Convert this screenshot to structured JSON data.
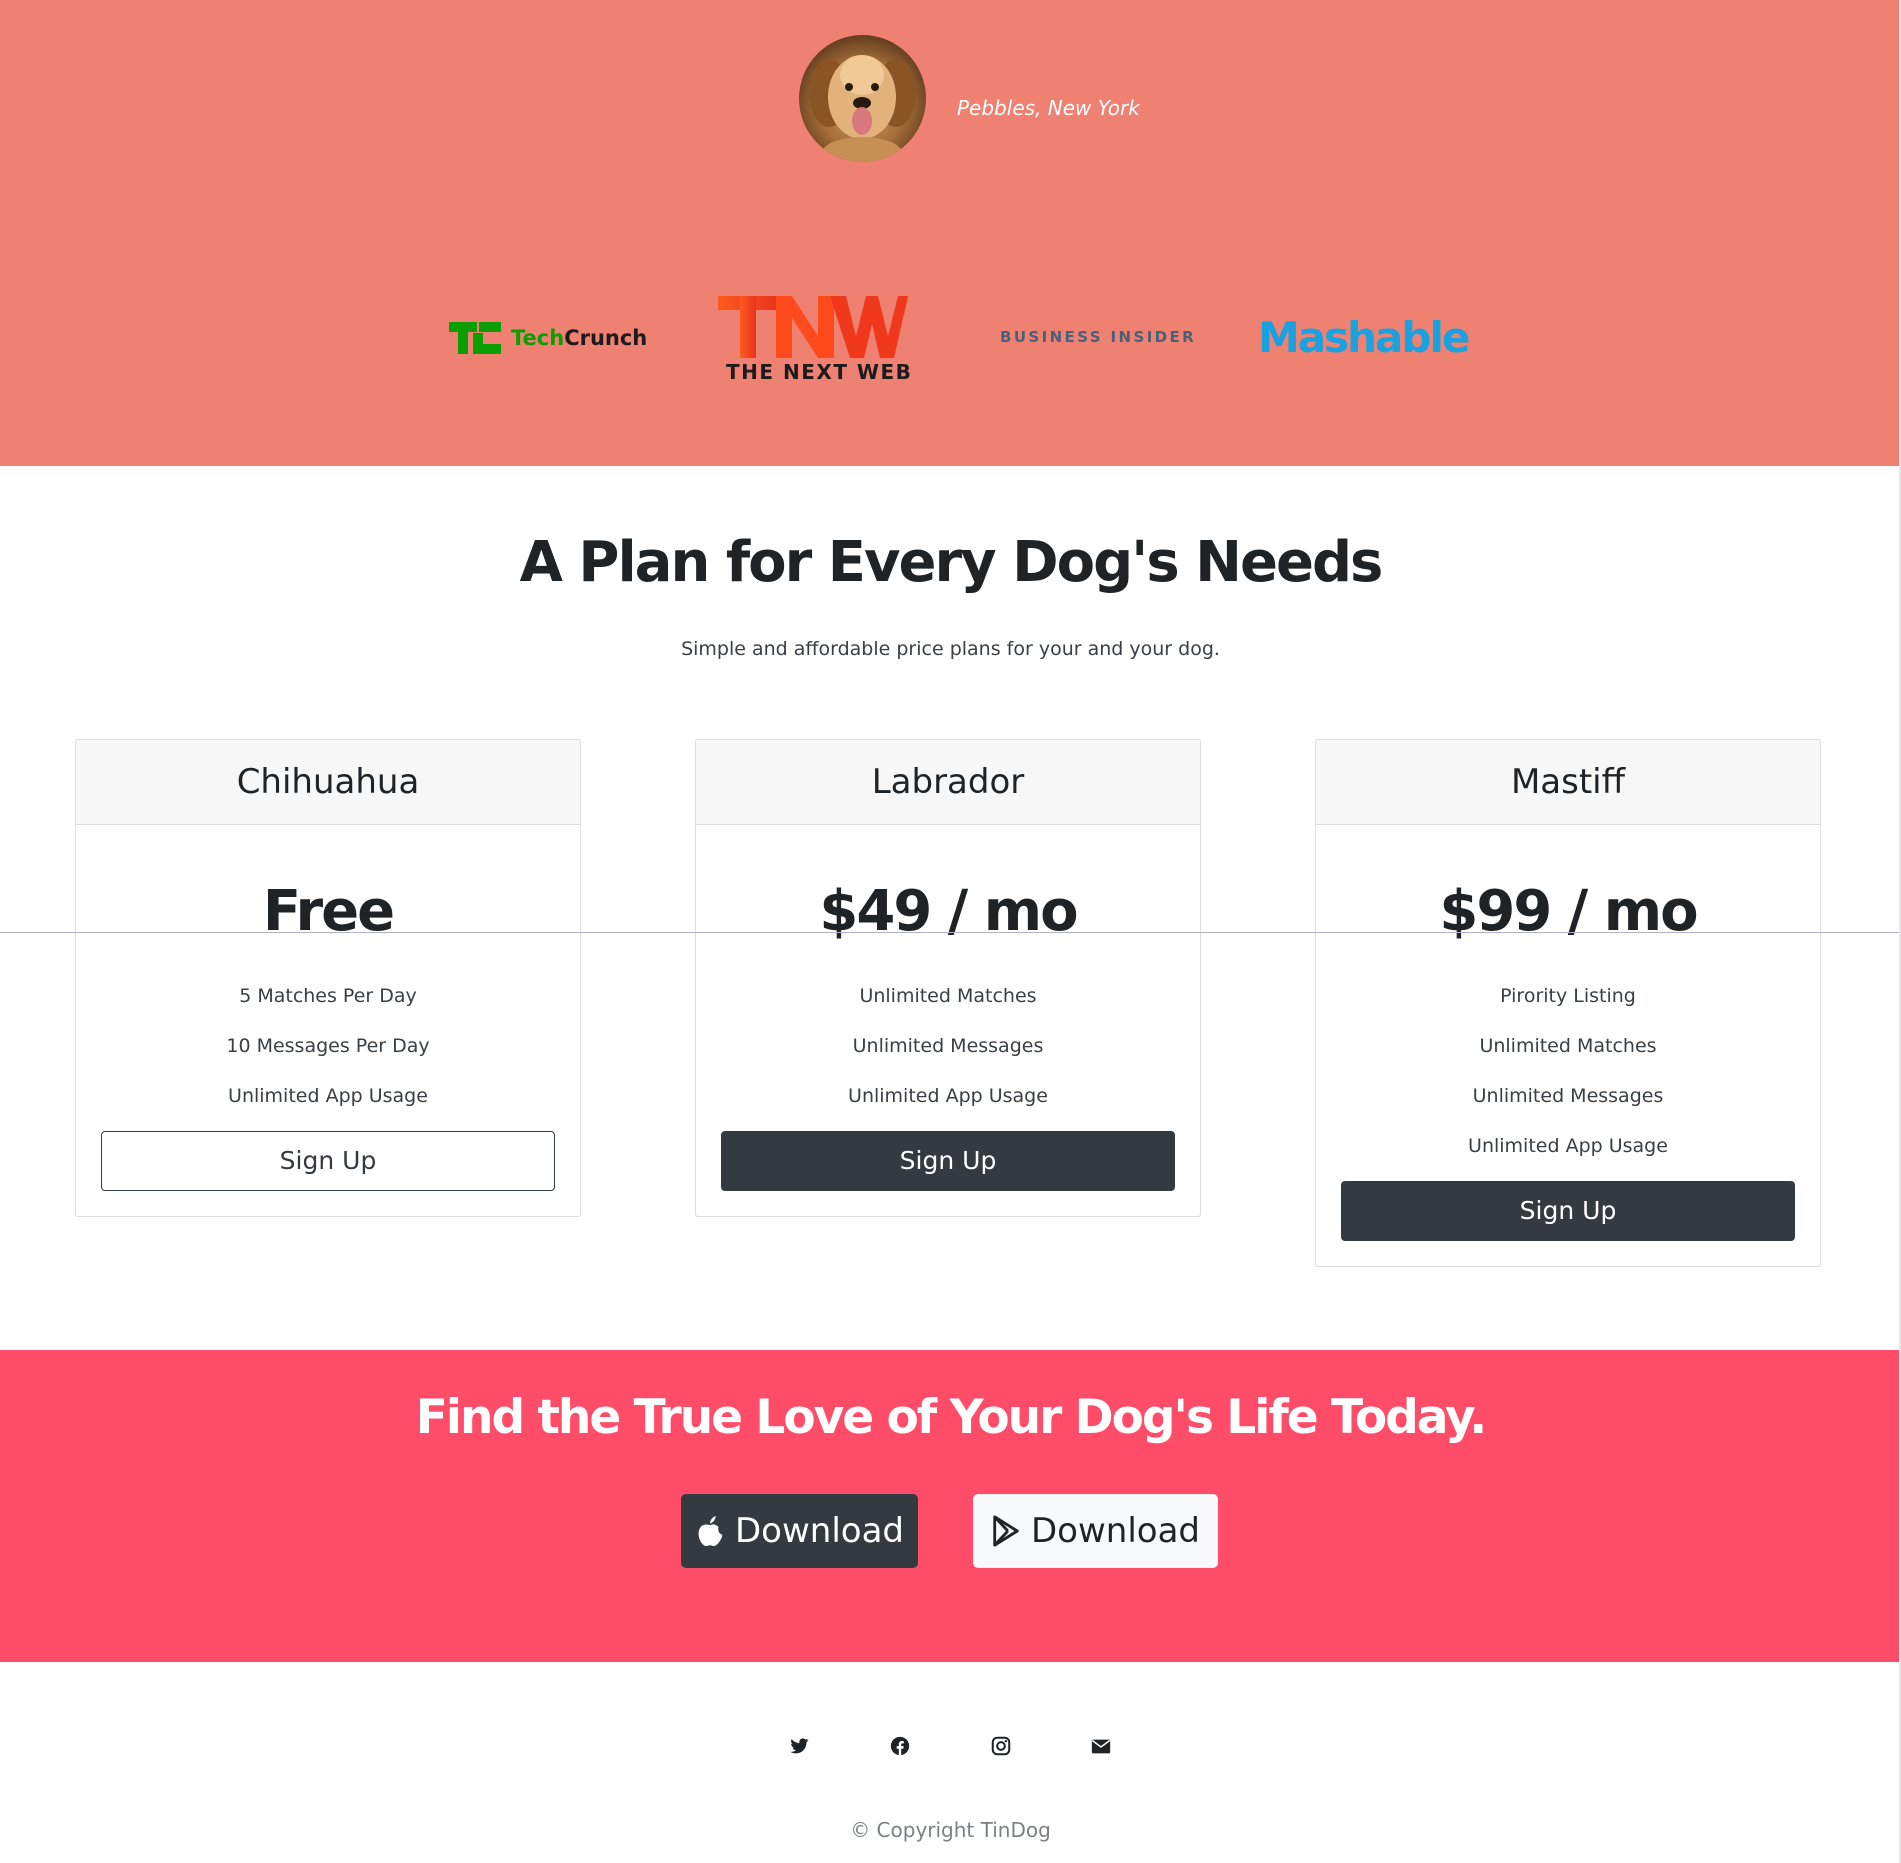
{
  "testimonial": {
    "name": "Pebbles, New York",
    "avatar_icon": "dog-photo"
  },
  "press": {
    "logos": [
      {
        "icon": "techcrunch-logo",
        "text_a": "Tech",
        "text_b": "Crunch"
      },
      {
        "icon": "tnw-logo",
        "big": "TNW",
        "sub": "THE NEXT WEB"
      },
      {
        "icon": "business-insider-logo",
        "text": "BUSINESS INSIDER"
      },
      {
        "icon": "mashable-logo",
        "text": "Mashable"
      }
    ]
  },
  "pricing": {
    "title": "A Plan for Every Dog's Needs",
    "subtitle": "Simple and affordable price plans for your and your dog.",
    "plans": [
      {
        "name": "Chihuahua",
        "price": "Free",
        "features": [
          "5 Matches Per Day",
          "10 Messages Per Day",
          "Unlimited App Usage"
        ],
        "button": "Sign Up"
      },
      {
        "name": "Labrador",
        "price": "$49 / mo",
        "features": [
          "Unlimited Matches",
          "Unlimited Messages",
          "Unlimited App Usage"
        ],
        "button": "Sign Up"
      },
      {
        "name": "Mastiff",
        "price": "$99 / mo",
        "features": [
          "Pirority Listing",
          "Unlimited Matches",
          "Unlimited Messages",
          "Unlimited App Usage"
        ],
        "button": "Sign Up"
      }
    ]
  },
  "cta": {
    "title": "Find the True Love of Your Dog's Life Today.",
    "apple_label": "Download",
    "play_label": "Download"
  },
  "footer": {
    "icons": [
      "twitter-icon",
      "facebook-icon",
      "instagram-icon",
      "envelope-icon"
    ],
    "copyright": "© Copyright TinDog"
  },
  "colors": {
    "press_bg": "#ef8172",
    "cta_bg": "#ff4c68",
    "dark_button": "#343a40"
  }
}
